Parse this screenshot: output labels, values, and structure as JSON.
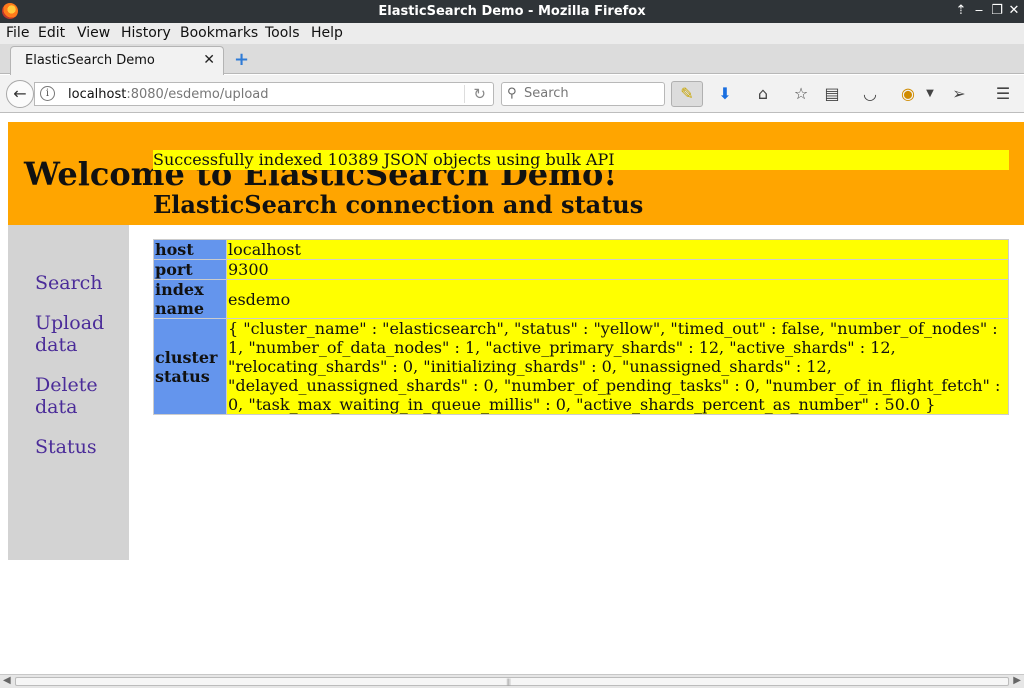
{
  "window": {
    "title": "ElasticSearch Demo - Mozilla Firefox"
  },
  "menu": [
    "File",
    "Edit",
    "View",
    "History",
    "Bookmarks",
    "Tools",
    "Help"
  ],
  "tab": {
    "label": "ElasticSearch Demo",
    "close": "✕",
    "new_tab": "+"
  },
  "navbar": {
    "url_host": "localhost",
    "url_path": ":8080/esdemo/upload",
    "search_placeholder": "Search"
  },
  "page": {
    "heading": "Welcome to ElasticSearch Demo!",
    "sidebar": [
      "Search",
      "Upload data",
      "Delete data",
      "Status"
    ],
    "success_message": "Successfully indexed 10389 JSON objects using bulk API",
    "section_title": "ElasticSearch connection and status",
    "status_table": [
      {
        "key": "host",
        "value": "localhost"
      },
      {
        "key": "port",
        "value": "9300"
      },
      {
        "key": "index name",
        "value": "esdemo"
      },
      {
        "key": "cluster status",
        "value": "{ \"cluster_name\" : \"elasticsearch\", \"status\" : \"yellow\", \"timed_out\" : false, \"number_of_nodes\" : 1, \"number_of_data_nodes\" : 1, \"active_primary_shards\" : 12, \"active_shards\" : 12, \"relocating_shards\" : 0, \"initializing_shards\" : 0, \"unassigned_shards\" : 12, \"delayed_unassigned_shards\" : 0, \"number_of_pending_tasks\" : 0, \"number_of_in_flight_fetch\" : 0, \"task_max_waiting_in_queue_millis\" : 0, \"active_shards_percent_as_number\" : 50.0 }"
      }
    ]
  },
  "colors": {
    "header_bg": "#ffa500",
    "sidebar_bg": "#d3d3d3",
    "link": "#4b2c99",
    "highlight": "#ffff00",
    "table_key_bg": "#6495ed"
  },
  "icons": {
    "back": "back-arrow-icon",
    "info": "info-icon",
    "reload": "reload-icon",
    "search": "search-icon",
    "highlighter": "highlighter-icon",
    "downloads": "download-icon",
    "home": "home-icon",
    "bookmark": "star-icon",
    "reading_list": "clipboard-icon",
    "pocket": "pocket-icon",
    "extension": "extension-icon",
    "send": "send-icon",
    "menu": "hamburger-menu-icon"
  }
}
